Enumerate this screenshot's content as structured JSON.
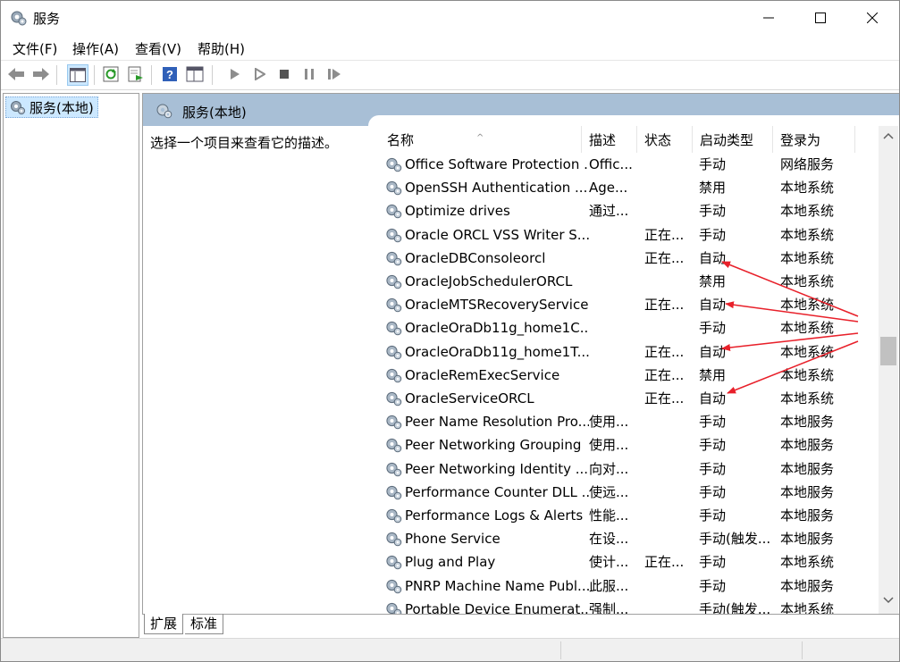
{
  "window": {
    "title": "服务"
  },
  "menu": [
    "文件(F)",
    "操作(A)",
    "查看(V)",
    "帮助(H)"
  ],
  "tree": {
    "root_label": "服务(本地)"
  },
  "panel": {
    "title": "服务(本地)",
    "description_prompt": "选择一个项目来查看它的描述。",
    "columns": [
      "名称",
      "描述",
      "状态",
      "启动类型",
      "登录为"
    ],
    "rows": [
      {
        "name": "Office Software Protection ...",
        "desc": "Offic...",
        "status": "",
        "type": "手动",
        "logon": "网络服务"
      },
      {
        "name": "OpenSSH Authentication ...",
        "desc": "Age...",
        "status": "",
        "type": "禁用",
        "logon": "本地系统"
      },
      {
        "name": "Optimize drives",
        "desc": "通过...",
        "status": "",
        "type": "手动",
        "logon": "本地系统"
      },
      {
        "name": "Oracle ORCL VSS Writer S...",
        "desc": "",
        "status": "正在...",
        "type": "手动",
        "logon": "本地系统"
      },
      {
        "name": "OracleDBConsoleorcl",
        "desc": "",
        "status": "正在...",
        "type": "自动",
        "logon": "本地系统"
      },
      {
        "name": "OracleJobSchedulerORCL",
        "desc": "",
        "status": "",
        "type": "禁用",
        "logon": "本地系统"
      },
      {
        "name": "OracleMTSRecoveryService",
        "desc": "",
        "status": "正在...",
        "type": "自动",
        "logon": "本地系统"
      },
      {
        "name": "OracleOraDb11g_home1C...",
        "desc": "",
        "status": "",
        "type": "手动",
        "logon": "本地系统"
      },
      {
        "name": "OracleOraDb11g_home1T...",
        "desc": "",
        "status": "正在...",
        "type": "自动",
        "logon": "本地系统"
      },
      {
        "name": "OracleRemExecService",
        "desc": "",
        "status": "正在...",
        "type": "禁用",
        "logon": "本地系统"
      },
      {
        "name": "OracleServiceORCL",
        "desc": "",
        "status": "正在...",
        "type": "自动",
        "logon": "本地系统"
      },
      {
        "name": "Peer Name Resolution Pro...",
        "desc": "使用...",
        "status": "",
        "type": "手动",
        "logon": "本地服务"
      },
      {
        "name": "Peer Networking Grouping",
        "desc": "使用...",
        "status": "",
        "type": "手动",
        "logon": "本地服务"
      },
      {
        "name": "Peer Networking Identity ...",
        "desc": "向对...",
        "status": "",
        "type": "手动",
        "logon": "本地服务"
      },
      {
        "name": "Performance Counter DLL ...",
        "desc": "使远...",
        "status": "",
        "type": "手动",
        "logon": "本地服务"
      },
      {
        "name": "Performance Logs & Alerts",
        "desc": "性能...",
        "status": "",
        "type": "手动",
        "logon": "本地服务"
      },
      {
        "name": "Phone Service",
        "desc": "在设...",
        "status": "",
        "type": "手动(触发...",
        "logon": "本地服务"
      },
      {
        "name": "Plug and Play",
        "desc": "使计...",
        "status": "正在...",
        "type": "手动",
        "logon": "本地系统"
      },
      {
        "name": "PNRP Machine Name Publ...",
        "desc": "此服...",
        "status": "",
        "type": "手动",
        "logon": "本地服务"
      },
      {
        "name": "Portable Device Enumerat...",
        "desc": "强制...",
        "status": "",
        "type": "手动(触发...",
        "logon": "本地系统"
      }
    ]
  },
  "tabs": [
    "扩展",
    "标准"
  ],
  "colors": {
    "panel_header": "#a8bfd6",
    "selection": "#cce8ff",
    "annotation": "#e8202a"
  }
}
